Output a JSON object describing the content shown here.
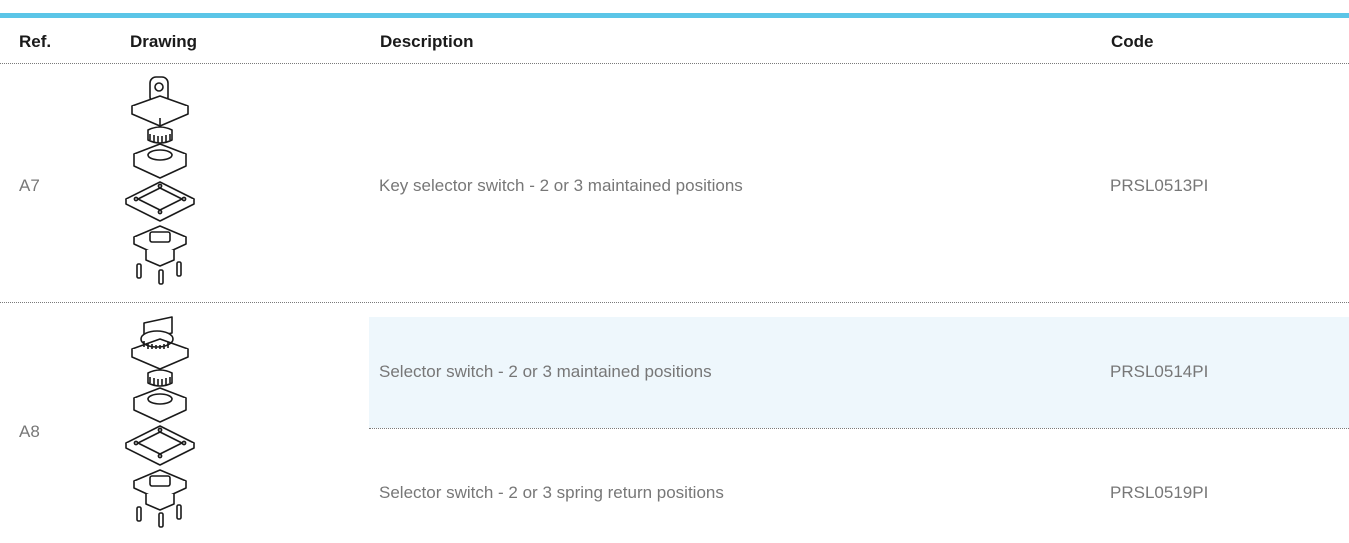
{
  "header": {
    "ref": "Ref.",
    "drawing": "Drawing",
    "description": "Description",
    "code": "Code"
  },
  "rows": [
    {
      "ref": "A7",
      "drawing_icon": "key-selector-switch-exploded-drawing",
      "items": [
        {
          "description": "Key selector switch - 2 or 3 maintained positions",
          "code": "PRSL0513PI",
          "highlighted": false
        }
      ]
    },
    {
      "ref": "A8",
      "drawing_icon": "selector-switch-exploded-drawing",
      "items": [
        {
          "description": "Selector switch - 2 or 3 maintained positions",
          "code": "PRSL0514PI",
          "highlighted": true
        },
        {
          "description": "Selector switch - 2 or 3 spring return positions",
          "code": "PRSL0519PI",
          "highlighted": false
        }
      ]
    }
  ],
  "colors": {
    "accent_bar": "#5bc5e7",
    "highlight_row": "#eef7fc",
    "text_muted": "#777777"
  }
}
